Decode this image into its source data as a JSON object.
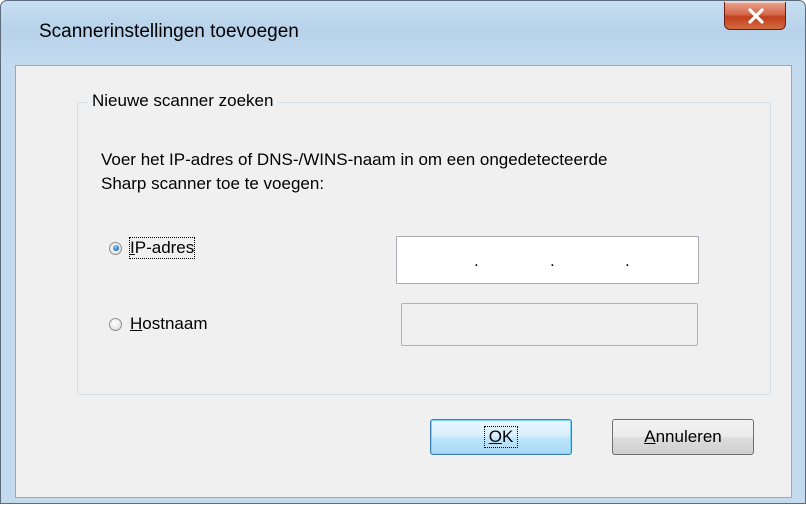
{
  "window": {
    "title": "Scannerinstellingen toevoegen"
  },
  "group": {
    "legend": "Nieuwe scanner zoeken",
    "description": "Voer het IP-adres of DNS-/WINS-naam in om een ongedetecteerde Sharp scanner toe te voegen:"
  },
  "options": {
    "ip": {
      "label_underlined": "I",
      "label_rest": "P-adres",
      "selected": true
    },
    "host": {
      "label_underlined": "H",
      "label_rest": "ostnaam",
      "selected": false
    }
  },
  "ip_field": {
    "dots": [
      ".",
      ".",
      "."
    ]
  },
  "buttons": {
    "ok_underlined": "O",
    "ok_rest": "K",
    "cancel_underlined": "A",
    "cancel_rest": "nnuleren"
  },
  "colors": {
    "close_button": "#c1401f",
    "default_button_border": "#3c7fb1",
    "titlebar": "#b7d2ea"
  },
  "icons": {
    "close": "close-icon",
    "radio_selected": "radio-selected",
    "radio_unselected": "radio-unselected"
  }
}
